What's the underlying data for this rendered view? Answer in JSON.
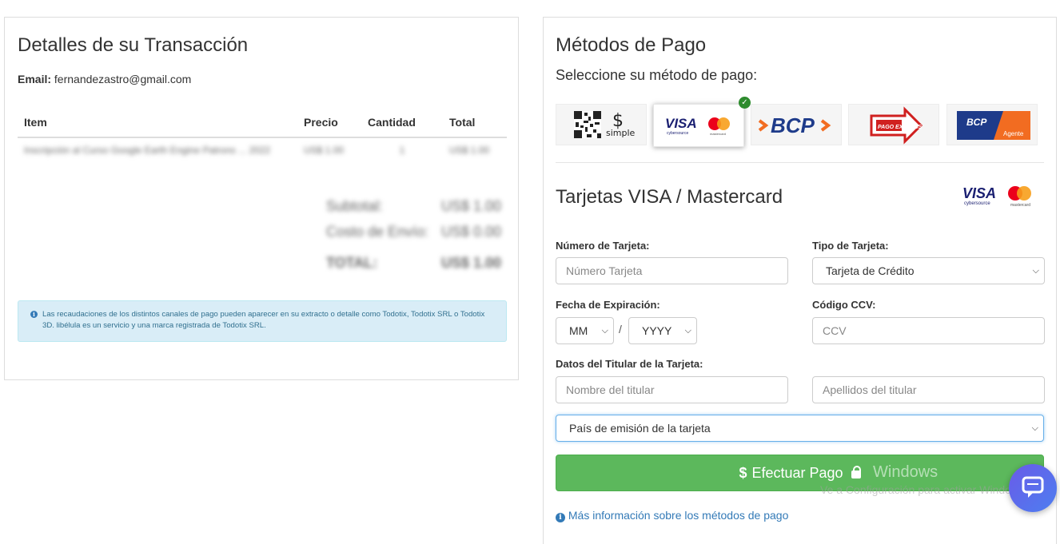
{
  "transaction": {
    "title": "Detalles de su Transacción",
    "email_label": "Email:",
    "email_value": "fernandezastro@gmail.com",
    "table_headers": [
      "Item",
      "Precio",
      "Cantidad",
      "Total"
    ],
    "rows": [
      {
        "item": "Inscripción al Curso Google Earth Engine Patrons ... 2022",
        "price": "US$ 1.00",
        "qty": "1",
        "total": "US$ 1.00"
      }
    ],
    "subtotal_label": "Subtotal:",
    "subtotal_value": "US$ 1.00",
    "shipping_label": "Costo de Envío:",
    "shipping_value": "US$ 0.00",
    "total_label": "TOTAL:",
    "total_value": "US$ 1.00",
    "notice": "Las recaudaciones de los distintos canales de pago pueden aparecer en su extracto o detalle como Todotix, Todotix SRL o Todotix 3D. libélula es un servicio y una marca registrada de Todotix SRL."
  },
  "payment": {
    "title": "Métodos de Pago",
    "subtitle": "Seleccione su método de pago:",
    "methods": [
      {
        "name": "QR Simple",
        "text": "simple"
      },
      {
        "name": "VISA / Mastercard",
        "text": "VISA"
      },
      {
        "name": "BCP",
        "text": "BCP"
      },
      {
        "name": "Pago Express",
        "text": "PAGO EXPRESS"
      },
      {
        "name": "BCP Agente",
        "text": "BCP",
        "sub": "Agente"
      }
    ],
    "selected_method": "VISA / Mastercard",
    "section_title": "Tarjetas VISA / Mastercard",
    "card_number_label": "Número de Tarjeta:",
    "card_number_placeholder": "Número Tarjeta",
    "card_type_label": "Tipo de Tarjeta:",
    "card_type_value": "Tarjeta de Crédito",
    "expiry_label": "Fecha de Expiración:",
    "month_value": "MM",
    "year_value": "YYYY",
    "expiry_separator": "/",
    "ccv_label": "Código CCV:",
    "ccv_placeholder": "CCV",
    "holder_label": "Datos del Titular de la Tarjeta:",
    "first_name_placeholder": "Nombre del titular",
    "last_name_placeholder": "Apellidos del titular",
    "country_value": "País de emisión de la tarjeta",
    "pay_button": "Efectuar Pago",
    "pay_icon": "$",
    "more_info": "Más información sobre los métodos de pago"
  },
  "os_overlay": {
    "line1": "Windows",
    "line2": "Ve a Configuración para activar Windows."
  },
  "colors": {
    "pay_button": "#5cb85c",
    "link": "#337ab7",
    "alert_bg": "#d9edf7",
    "check": "#2e8b2e",
    "chat": "#5a6ef0"
  }
}
